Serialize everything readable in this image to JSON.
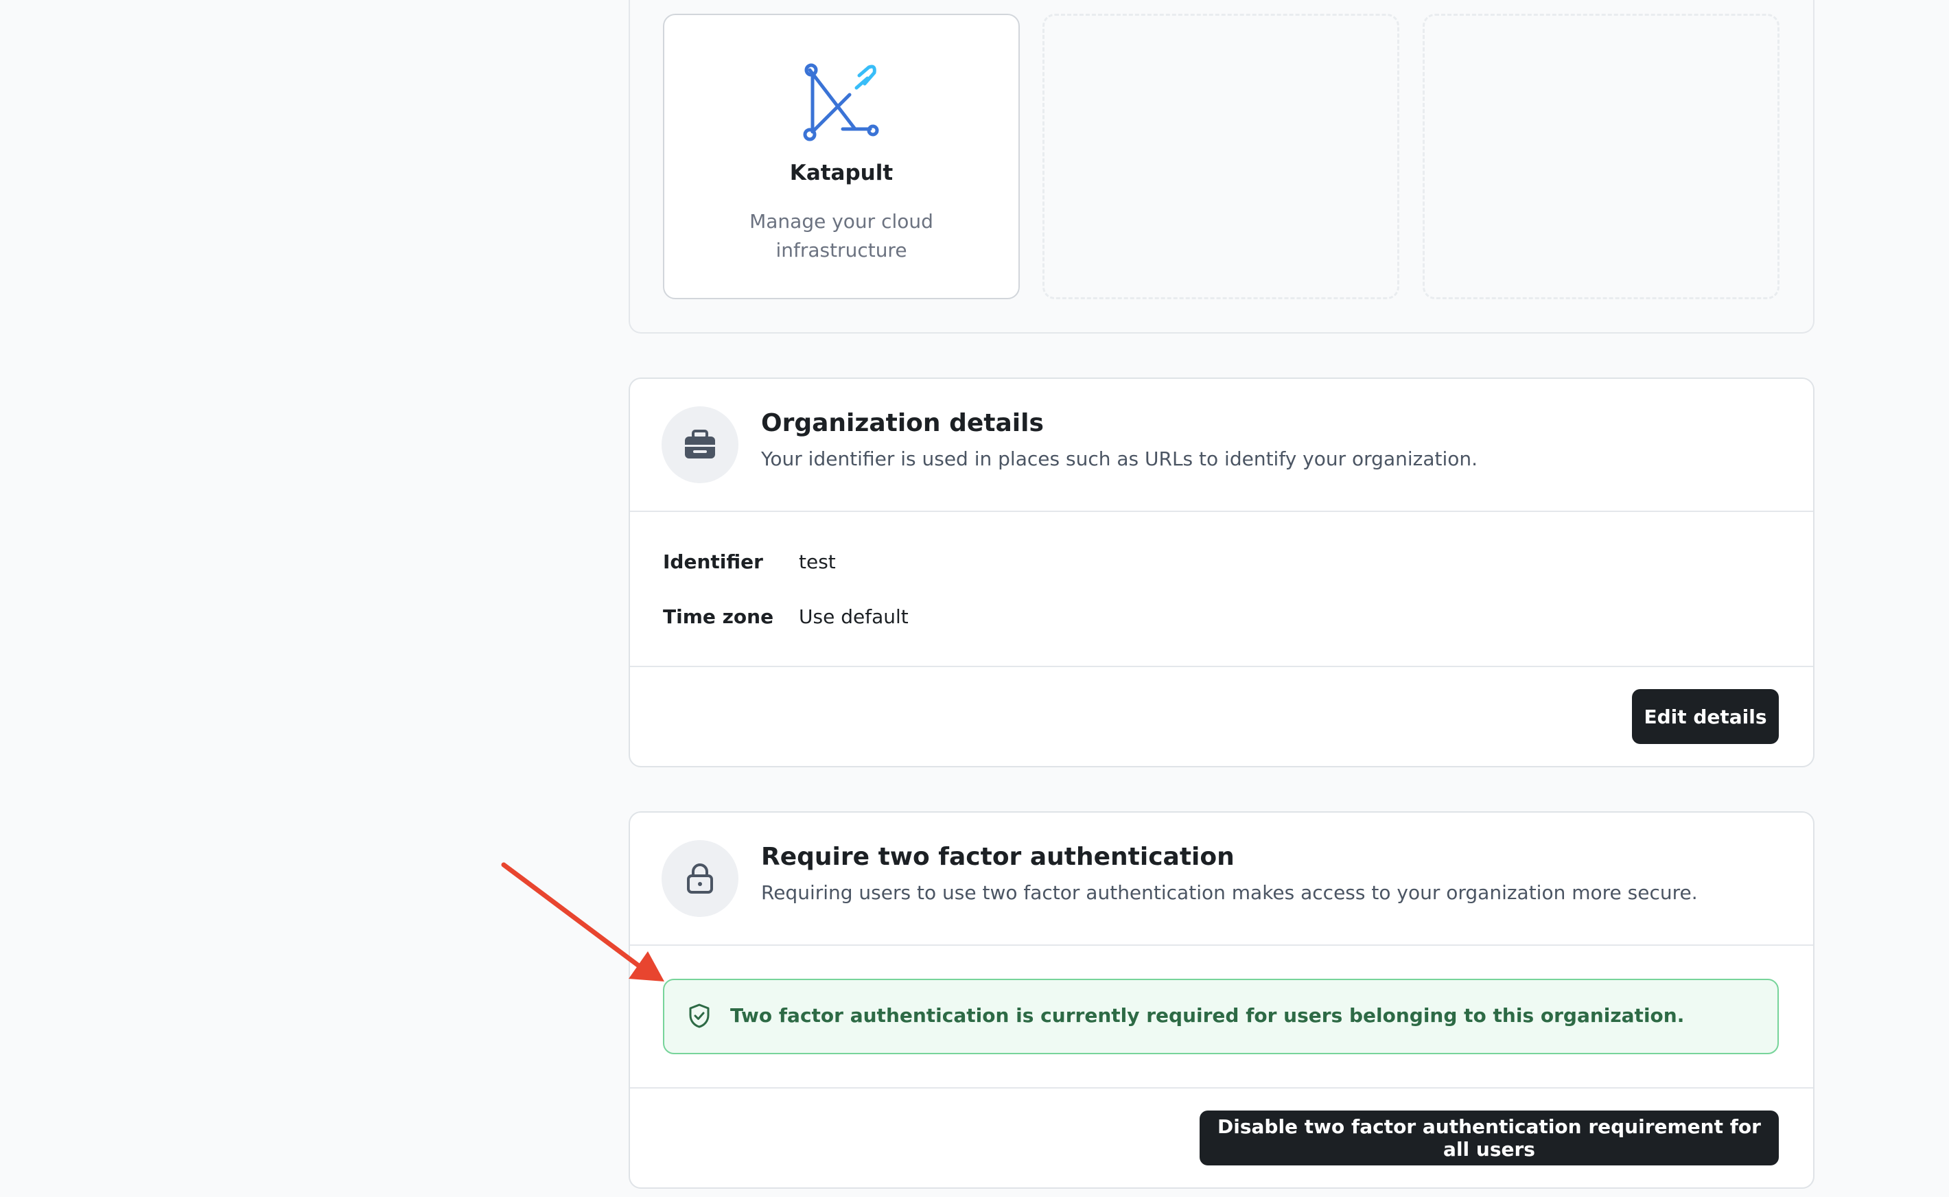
{
  "products": {
    "cards": [
      {
        "name": "Katapult",
        "description": "Manage your cloud infrastructure",
        "icon": "katapult-logo-icon"
      }
    ],
    "empty_slots": 2
  },
  "organization_details": {
    "title": "Organization details",
    "subtitle": "Your identifier is used in places such as URLs to identify your organization.",
    "icon": "briefcase-icon",
    "fields": [
      {
        "label": "Identifier",
        "value": "test"
      },
      {
        "label": "Time zone",
        "value": "Use default"
      }
    ],
    "edit_button_label": "Edit details"
  },
  "two_factor": {
    "title": "Require two factor authentication",
    "subtitle": "Requiring users to use two factor authentication makes access to your organization more secure.",
    "icon": "lock-icon",
    "notice_text": "Two factor authentication is currently required for users belonging to this organization.",
    "notice_icon": "shield-check-icon",
    "disable_button_label": "Disable two factor authentication requirement for all users"
  },
  "annotation": {
    "arrow_color": "#e8452f"
  },
  "colors": {
    "primary_button": "#1c2024",
    "success_border": "#77d49a",
    "success_bg": "#effaf3",
    "success_text": "#2d6a45",
    "logo_blue": "#3a73d6",
    "logo_cyan": "#38bdf8"
  }
}
